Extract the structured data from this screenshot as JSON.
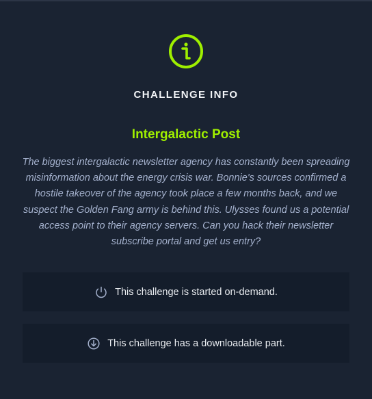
{
  "panel": {
    "heading": "CHALLENGE INFO",
    "info_icon": "info-circle-icon",
    "challenge_name": "Intergalactic Post",
    "description": "The biggest intergalactic newsletter agency has constantly been spreading misinformation about the energy crisis war. Bonnie's sources confirmed a hostile takeover of the agency took place a few months back, and we suspect the Golden Fang army is behind this. Ulysses found us a potential access point to their agency servers. Can you hack their newsletter subscribe portal and get us entry?",
    "cards": [
      {
        "icon": "power-icon",
        "text": "This challenge is started on-demand."
      },
      {
        "icon": "download-icon",
        "text": "This challenge has a downloadable part."
      }
    ]
  },
  "colors": {
    "background": "#1a2332",
    "card_background": "#141d2b",
    "accent": "#9fef00",
    "description_text": "#a4b1cd",
    "icon_stroke": "#a4b1cd"
  }
}
